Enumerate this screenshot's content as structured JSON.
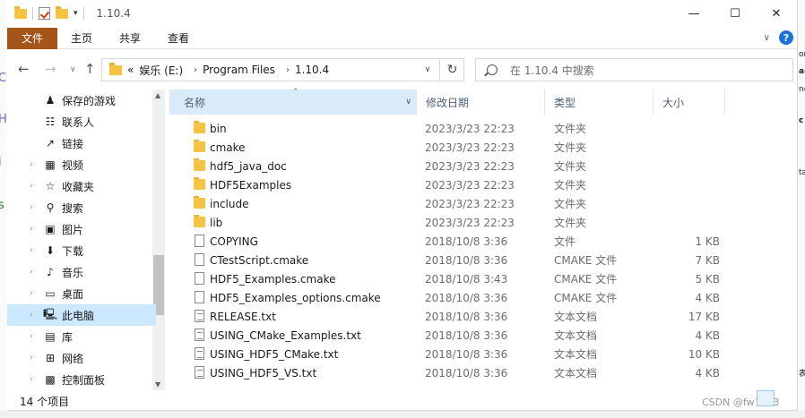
{
  "window": {
    "title": "1.10.4",
    "controls": [
      "—",
      "☐",
      "✕"
    ]
  },
  "ribbon": {
    "tabs": [
      "文件",
      "主页",
      "共享",
      "查看"
    ]
  },
  "address": {
    "crumbs": [
      "«",
      "娱乐 (E:)",
      "Program Files",
      "1.10.4"
    ],
    "search_placeholder": "在 1.10.4 中搜索"
  },
  "nav": {
    "items": [
      {
        "label": "保存的游戏",
        "icon": "saved-games-icon",
        "glyph": "♟"
      },
      {
        "label": "联系人",
        "icon": "contacts-icon",
        "glyph": "☷"
      },
      {
        "label": "链接",
        "icon": "links-icon",
        "glyph": "↗"
      },
      {
        "label": "视频",
        "icon": "videos-icon",
        "glyph": "▦"
      },
      {
        "label": "收藏夹",
        "icon": "favorites-icon",
        "glyph": "☆"
      },
      {
        "label": "搜索",
        "icon": "search-icon",
        "glyph": "⚲"
      },
      {
        "label": "图片",
        "icon": "pictures-icon",
        "glyph": "▣"
      },
      {
        "label": "下载",
        "icon": "downloads-icon",
        "glyph": "⬇"
      },
      {
        "label": "音乐",
        "icon": "music-icon",
        "glyph": "♪"
      },
      {
        "label": "桌面",
        "icon": "desktop-icon",
        "glyph": "▭"
      },
      {
        "label": "此电脑",
        "icon": "this-pc-icon",
        "glyph": "🖳"
      },
      {
        "label": "库",
        "icon": "library-icon",
        "glyph": "▤"
      },
      {
        "label": "网络",
        "icon": "network-icon",
        "glyph": "⊞"
      },
      {
        "label": "控制面板",
        "icon": "control-panel-icon",
        "glyph": "▩"
      }
    ]
  },
  "columns": {
    "name": "名称",
    "date": "修改日期",
    "type": "类型",
    "size": "大小"
  },
  "files": [
    {
      "name": "bin",
      "date": "2023/3/23 22:23",
      "type": "文件夹",
      "size": "",
      "kind": "folder"
    },
    {
      "name": "cmake",
      "date": "2023/3/23 22:23",
      "type": "文件夹",
      "size": "",
      "kind": "folder"
    },
    {
      "name": "hdf5_java_doc",
      "date": "2023/3/23 22:23",
      "type": "文件夹",
      "size": "",
      "kind": "folder"
    },
    {
      "name": "HDF5Examples",
      "date": "2023/3/23 22:23",
      "type": "文件夹",
      "size": "",
      "kind": "folder"
    },
    {
      "name": "include",
      "date": "2023/3/23 22:23",
      "type": "文件夹",
      "size": "",
      "kind": "folder"
    },
    {
      "name": "lib",
      "date": "2023/3/23 22:23",
      "type": "文件夹",
      "size": "",
      "kind": "folder"
    },
    {
      "name": "COPYING",
      "date": "2018/10/8 3:36",
      "type": "文件",
      "size": "1 KB",
      "kind": "doc"
    },
    {
      "name": "CTestScript.cmake",
      "date": "2018/10/8 3:36",
      "type": "CMAKE 文件",
      "size": "7 KB",
      "kind": "doc"
    },
    {
      "name": "HDF5_Examples.cmake",
      "date": "2018/10/8 3:43",
      "type": "CMAKE 文件",
      "size": "5 KB",
      "kind": "doc"
    },
    {
      "name": "HDF5_Examples_options.cmake",
      "date": "2018/10/8 3:36",
      "type": "CMAKE 文件",
      "size": "4 KB",
      "kind": "doc"
    },
    {
      "name": "RELEASE.txt",
      "date": "2018/10/8 3:36",
      "type": "文本文档",
      "size": "17 KB",
      "kind": "txt"
    },
    {
      "name": "USING_CMake_Examples.txt",
      "date": "2018/10/8 3:36",
      "type": "文本文档",
      "size": "4 KB",
      "kind": "txt"
    },
    {
      "name": "USING_HDF5_CMake.txt",
      "date": "2018/10/8 3:36",
      "type": "文本文档",
      "size": "10 KB",
      "kind": "txt"
    },
    {
      "name": "USING_HDF5_VS.txt",
      "date": "2018/10/8 3:36",
      "type": "文本文档",
      "size": "4 KB",
      "kind": "txt"
    }
  ],
  "status": {
    "count": "14 个项目"
  },
  "watermark": "CSDN @fw7123"
}
